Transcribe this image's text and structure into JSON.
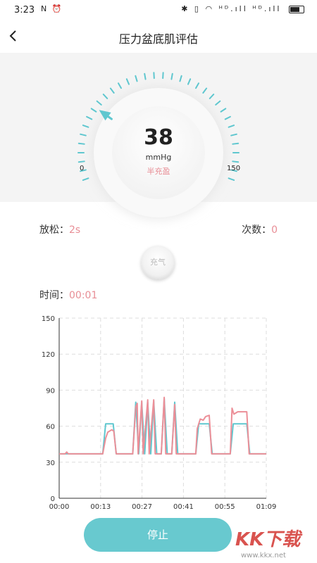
{
  "status_bar": {
    "time": "3:23",
    "left_icons": "N ⏰",
    "right_icons": "✱ ▯ ◠ ᴴᴰ.ıll ᴴᴰ.ıll"
  },
  "nav": {
    "title": "压力盆底肌评估"
  },
  "gauge": {
    "value": "38",
    "unit": "mmHg",
    "status": "半充盈",
    "min_label": "0",
    "max_label": "150",
    "min": 0,
    "max": 150,
    "level": 38,
    "accent_color": "#5fc7cf"
  },
  "relax": {
    "label": "放松：",
    "value": "2s"
  },
  "count": {
    "label": "次数：",
    "value": "0"
  },
  "inflate_button": {
    "label": "充气"
  },
  "timer": {
    "label": "时间：",
    "value": "00:01"
  },
  "chart_data": {
    "type": "line",
    "title": "",
    "xlabel": "",
    "ylabel": "",
    "x_ticks": [
      "00:00",
      "00:13",
      "00:27",
      "00:41",
      "00:55",
      "01:09"
    ],
    "y_ticks": [
      "0",
      "30",
      "60",
      "90",
      "120",
      "150"
    ],
    "xlim": [
      0,
      69
    ],
    "ylim": [
      0,
      150
    ],
    "grid": true,
    "series": [
      {
        "color": "#5fc7cf",
        "points": [
          [
            0,
            37
          ],
          [
            14.5,
            37
          ],
          [
            15.5,
            62
          ],
          [
            18,
            62
          ],
          [
            19,
            37
          ],
          [
            24.5,
            37
          ],
          [
            25.5,
            80
          ],
          [
            26.5,
            37
          ],
          [
            27.5,
            80
          ],
          [
            28.5,
            37
          ],
          [
            29.5,
            80
          ],
          [
            30.5,
            37
          ],
          [
            31.5,
            81
          ],
          [
            32.5,
            37
          ],
          [
            34,
            37
          ],
          [
            35,
            83
          ],
          [
            36,
            37
          ],
          [
            37.5,
            37
          ],
          [
            38.5,
            80
          ],
          [
            39.5,
            37
          ],
          [
            45.5,
            37
          ],
          [
            46.5,
            62
          ],
          [
            50,
            62
          ],
          [
            51,
            37
          ],
          [
            57,
            37
          ],
          [
            58,
            62
          ],
          [
            62.5,
            62
          ],
          [
            63.5,
            37
          ],
          [
            69,
            37
          ]
        ]
      },
      {
        "color": "#ec8f98",
        "points": [
          [
            0,
            37
          ],
          [
            2,
            37
          ],
          [
            2.5,
            38.5
          ],
          [
            3,
            37
          ],
          [
            14.5,
            37
          ],
          [
            15.5,
            50
          ],
          [
            16.2,
            55
          ],
          [
            17.5,
            57
          ],
          [
            18.2,
            56
          ],
          [
            19,
            37
          ],
          [
            24.5,
            37
          ],
          [
            25.5,
            76
          ],
          [
            26,
            79
          ],
          [
            26.3,
            37
          ],
          [
            27.5,
            81
          ],
          [
            28,
            37
          ],
          [
            29.5,
            82
          ],
          [
            30,
            37
          ],
          [
            31.5,
            82
          ],
          [
            32,
            37
          ],
          [
            34,
            37
          ],
          [
            35,
            84
          ],
          [
            35.5,
            37
          ],
          [
            37.5,
            37
          ],
          [
            38.5,
            78
          ],
          [
            39,
            37
          ],
          [
            45.5,
            37
          ],
          [
            46,
            58
          ],
          [
            47,
            66
          ],
          [
            48,
            65
          ],
          [
            48.8,
            68
          ],
          [
            50,
            69
          ],
          [
            50.8,
            37
          ],
          [
            57,
            37
          ],
          [
            57.6,
            75
          ],
          [
            58.2,
            70
          ],
          [
            59.5,
            72
          ],
          [
            61,
            72
          ],
          [
            62.5,
            72
          ],
          [
            63.3,
            37
          ],
          [
            69,
            37
          ]
        ]
      }
    ]
  },
  "stop_button": {
    "label": "停止"
  },
  "watermark": {
    "logo": "KK下载",
    "url": "www.kkx.net"
  }
}
